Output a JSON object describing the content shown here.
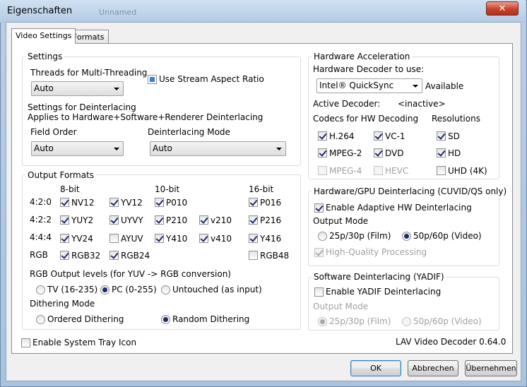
{
  "window": {
    "title": "Eigenschaften",
    "ghost_title": "Unnamed",
    "close_glyph": "✕"
  },
  "tabs": [
    "Video Settings",
    "Formats"
  ],
  "settings": {
    "group": "Settings",
    "threads_label": "Threads for Multi-Threading",
    "threads_value": "Auto",
    "stream_aspect": "Use Stream Aspect Ratio",
    "deint_title": "Settings for Deinterlacing",
    "deint_sub": "Applies to Hardware+Software+Renderer Deinterlacing",
    "field_order_label": "Field Order",
    "field_order_value": "Auto",
    "deint_mode_label": "Deinterlacing Mode",
    "deint_mode_value": "Auto"
  },
  "output": {
    "group": "Output Formats",
    "headers": [
      "8-bit",
      "10-bit",
      "16-bit"
    ],
    "rows": [
      "4:2:0",
      "4:2:2",
      "4:4:4",
      "RGB"
    ],
    "formats": {
      "nv12": "NV12",
      "yv12": "YV12",
      "p010": "P010",
      "p016": "P016",
      "yuy2": "YUY2",
      "uyvy": "UYVY",
      "p210": "P210",
      "v210": "v210",
      "p216": "P216",
      "yv24": "YV24",
      "ayuv": "AYUV",
      "y410": "Y410",
      "v410": "v410",
      "y416": "Y416",
      "rgb32": "RGB32",
      "rgb24": "RGB24",
      "rgb48": "RGB48"
    },
    "rgb_levels_label": "RGB Output levels (for YUV -> RGB conversion)",
    "levels": [
      "TV (16-235)",
      "PC (0-255)",
      "Untouched (as input)"
    ],
    "dither_label": "Dithering Mode",
    "dither": [
      "Ordered Dithering",
      "Random Dithering"
    ]
  },
  "hw": {
    "group": "Hardware Acceleration",
    "decoder_label": "Hardware Decoder to use:",
    "decoder_value": "Intel® QuickSync",
    "available": "Available",
    "active_label": "Active Decoder:",
    "active_value": "<inactive>",
    "codecs_label": "Codecs for HW Decoding",
    "resolutions_label": "Resolutions",
    "codecs": {
      "h264": "H.264",
      "vc1": "VC-1",
      "mpeg2": "MPEG-2",
      "dvd": "DVD",
      "mpeg4": "MPEG-4",
      "hevc": "HEVC"
    },
    "res": {
      "sd": "SD",
      "hd": "HD",
      "uhd": "UHD (4K)"
    }
  },
  "gpu_deint": {
    "group": "Hardware/GPU Deinterlacing (CUVID/QS only)",
    "enable": "Enable Adaptive HW Deinterlacing",
    "mode_label": "Output Mode",
    "film": "25p/30p (Film)",
    "video": "50p/60p (Video)",
    "hq": "High-Quality Processing"
  },
  "sw_deint": {
    "group": "Software Deinterlacing (YADIF)",
    "enable": "Enable YADIF Deinterlacing",
    "mode_label": "Output Mode",
    "film": "25p/30p (Film)",
    "video": "50p/60p (Video)"
  },
  "tray": "Enable System Tray Icon",
  "version": "LAV Video Decoder 0.64.0",
  "buttons": {
    "ok": "OK",
    "cancel": "Abbrechen",
    "apply": "Übernehmen"
  }
}
